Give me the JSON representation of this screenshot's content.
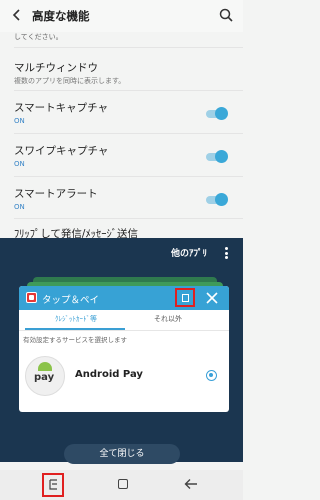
{
  "settings": {
    "title": "高度な機能",
    "partial_text": "してください。",
    "rows": [
      {
        "title": "マルチウィンドウ",
        "sub": "複数のアプリを同時に表示します。"
      },
      {
        "title": "スマートキャプチャ",
        "sub": "ON"
      },
      {
        "title": "スワイプキャプチャ",
        "sub": "ON"
      },
      {
        "title": "スマートアラート",
        "sub": "ON"
      },
      {
        "title": "ﾌﾘｯﾌﾟして発信/ﾒｯｾｰｼﾞ送信"
      }
    ]
  },
  "recents": {
    "others_label": "他のｱﾌﾟﾘ",
    "card": {
      "title": "タップ＆ペイ",
      "tabs": [
        "ｸﾚｼﾞｯﾄｶｰﾄﾞ等",
        "それ以外"
      ],
      "description": "有効設定するサービスを選択します",
      "service_name": "Android Pay",
      "service_logo_text": "pay"
    },
    "close_all_label": "全て閉じる"
  },
  "colors": {
    "accent": "#37a2d5",
    "highlight_box": "#e02020",
    "overlay_bg": "#1b3650"
  }
}
